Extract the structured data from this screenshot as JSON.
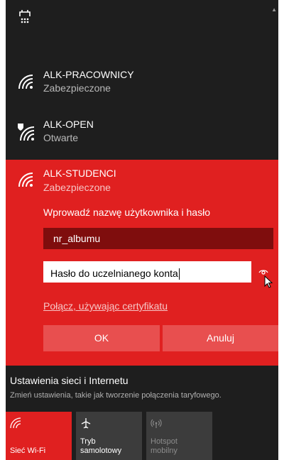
{
  "networks": [
    {
      "name": "ALK-PRACOWNICY",
      "status": "Zabezpieczone"
    },
    {
      "name": "ALK-OPEN",
      "status": "Otwarte"
    }
  ],
  "expanded": {
    "name": "ALK-STUDENCI",
    "status": "Zabezpieczone",
    "prompt": "Wprowadź nazwę użytkownika i hasło",
    "username_value": "nr_albumu",
    "password_value": "Hasło do uczelnianego konta",
    "cert_link": "Połącz, używając certyfikatu",
    "ok_label": "OK",
    "cancel_label": "Anuluj"
  },
  "settings": {
    "title": "Ustawienia sieci i Internetu",
    "description": "Zmień ustawienia, takie jak tworzenie połączenia taryfowego."
  },
  "quick_actions": [
    {
      "label": "Sieć Wi-Fi"
    },
    {
      "label_line1": "Tryb",
      "label_line2": "samolotowy"
    },
    {
      "label_line1": "Hotspot",
      "label_line2": "mobilny"
    }
  ],
  "colors": {
    "accent": "#e02020",
    "dark_accent": "#7f0d0d",
    "button": "#e84f4f",
    "background": "#1e1e1e"
  }
}
